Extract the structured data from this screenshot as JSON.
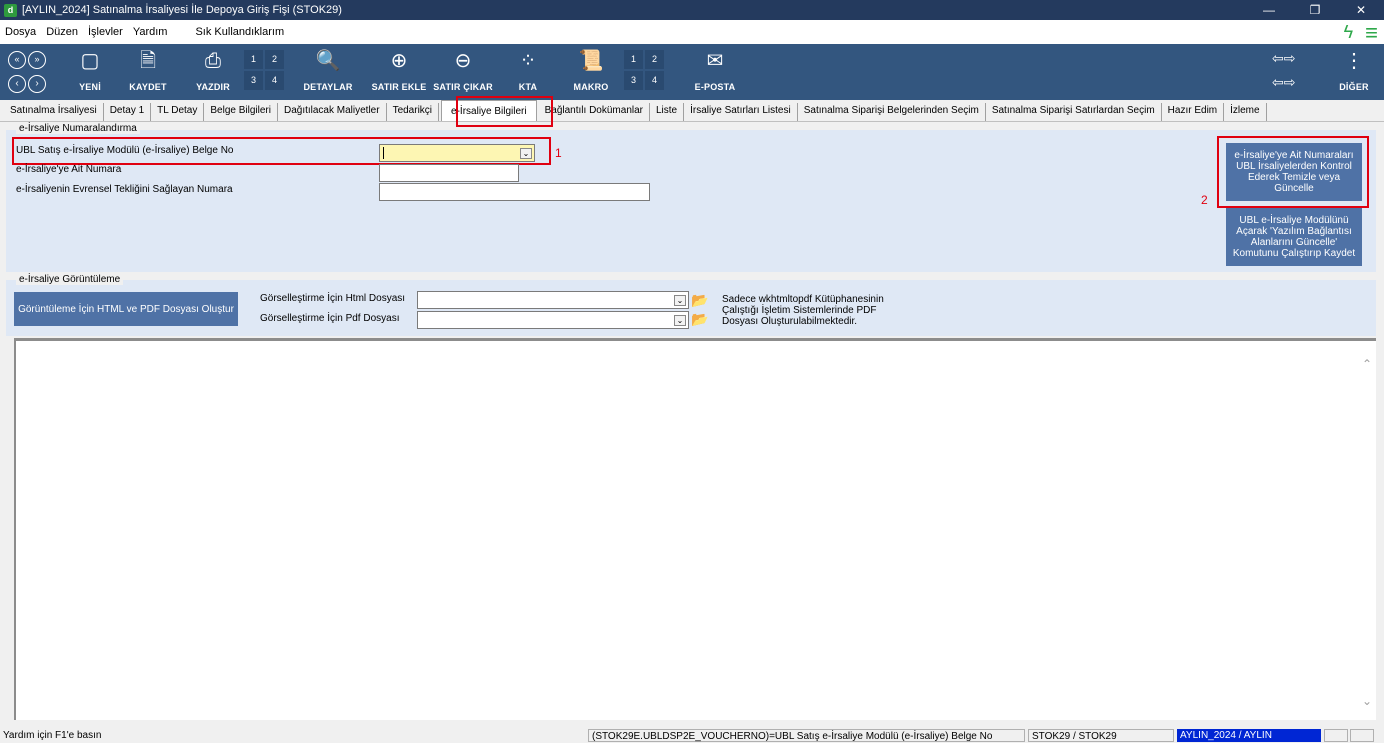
{
  "window": {
    "title": "[AYLIN_2024] Satınalma İrsaliyesi İle Depoya Giriş Fişi (STOK29)",
    "app_icon_letter": "d",
    "minimize": "—",
    "restore": "❐",
    "close": "✕"
  },
  "menu": {
    "items": [
      "Dosya",
      "Düzen",
      "İşlevler",
      "Yardım"
    ],
    "favorites": "Sık Kullandıklarım"
  },
  "toolbar": {
    "new": "YENİ",
    "save": "KAYDET",
    "print": "YAZDIR",
    "print_grid": [
      "1",
      "2",
      "3",
      "4"
    ],
    "details": "DETAYLAR",
    "add_row": "SATIR EKLE",
    "remove_row": "SATIR ÇIKAR",
    "kta": "KTA",
    "macro": "MAKRO",
    "macro_grid": [
      "1",
      "2",
      "3",
      "4"
    ],
    "email": "E-POSTA",
    "other": "DİĞER"
  },
  "tabs": [
    "Satınalma İrsaliyesi",
    "Detay 1",
    "TL Detay",
    "Belge Bilgileri",
    "Dağıtılacak Maliyetler",
    "Tedarikçi",
    "e-İrsaliye Bilgileri",
    "Bağlantılı Dokümanlar",
    "Liste",
    "İrsaliye Satırları Listesi",
    "Satınalma Siparişi Belgelerinden Seçim",
    "Satınalma Siparişi Satırlardan Seçim",
    "Hazır Edim",
    "İzleme"
  ],
  "active_tab_index": 6,
  "numbering": {
    "group_label": "e-İrsaliye Numaralandırma",
    "field1_label": "UBL Satış e-İrsaliye Modülü (e-İrsaliye) Belge No",
    "field1_value": "",
    "field2_label": "e-İrsaliye'ye Ait Numara",
    "field2_value": "",
    "field3_label": "e-İrsaliyenin Evrensel Tekliğini Sağlayan Numara",
    "field3_value": "",
    "btn_check": "e-İrsaliye'ye Ait Numaraları UBL İrsaliyelerden Kontrol Ederek Temizle veya Güncelle",
    "btn_module": "UBL e-İrsaliye Modülünü Açarak 'Yazılım Bağlantısı Alanlarını Güncelle' Komutunu Çalıştırıp Kaydet",
    "marker1": "1",
    "marker2": "2"
  },
  "display": {
    "group_label": "e-İrsaliye Görüntüleme",
    "create_button": "Görüntüleme İçin HTML ve PDF Dosyası Oluştur",
    "html_label": "Görselleştirme İçin Html Dosyası",
    "html_value": "",
    "pdf_label": "Görselleştirme İçin Pdf Dosyası",
    "pdf_value": "",
    "note_line1": "Sadece wkhtmltopdf Kütüphanesinin",
    "note_line2": "Çalıştığı İşletim Sistemlerinde PDF",
    "note_line3": "Dosyası Oluşturulabilmektedir."
  },
  "status": {
    "help": "Yardım için F1'e basın",
    "field_info": "(STOK29E.UBLDSP2E_VOUCHERNO)=UBL Satış e-İrsaliye Modülü (e-İrsaliye) Belge No",
    "program": "STOK29 / STOK29",
    "company": "AYLIN_2024 / AYLIN"
  },
  "colors": {
    "titlebar": "#243a5e",
    "toolbar": "#33567f",
    "group_bg": "#dfe8f5",
    "highlight": "#e00010",
    "status_blue": "#0026d4",
    "accent_green": "#2ea84a"
  }
}
